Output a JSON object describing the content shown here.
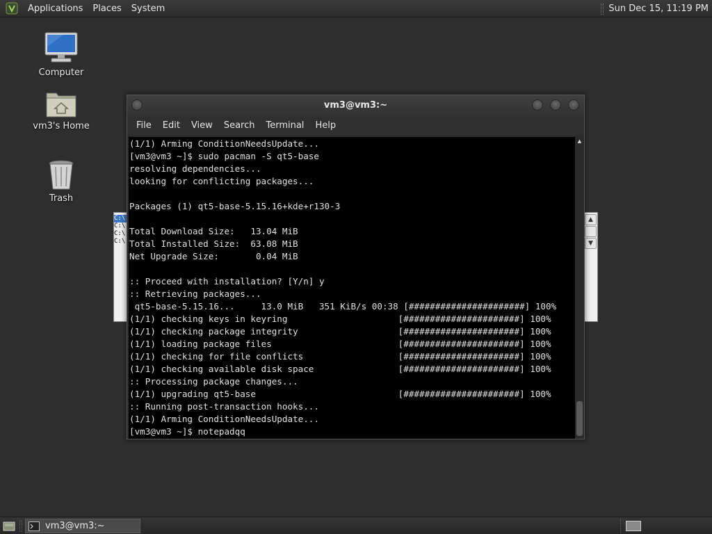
{
  "top_panel": {
    "menus": [
      "Applications",
      "Places",
      "System"
    ],
    "clock": "Sun Dec 15, 11:19 PM"
  },
  "desktop_icons": [
    {
      "label": "Computer",
      "icon": "computer-icon"
    },
    {
      "label": "vm3's Home",
      "icon": "home-folder-icon"
    },
    {
      "label": "Trash",
      "icon": "trash-icon"
    }
  ],
  "background_window": {
    "lines": [
      "C:\\",
      "C:\\",
      "C:\\",
      "C:\\"
    ]
  },
  "terminal": {
    "title": "vm3@vm3:~",
    "menu": [
      "File",
      "Edit",
      "View",
      "Search",
      "Terminal",
      "Help"
    ],
    "lines": [
      "(1/1) Arming ConditionNeedsUpdate...",
      "[vm3@vm3 ~]$ sudo pacman -S qt5-base",
      "resolving dependencies...",
      "looking for conflicting packages...",
      "",
      "Packages (1) qt5-base-5.15.16+kde+r130-3",
      "",
      "Total Download Size:   13.04 MiB",
      "Total Installed Size:  63.08 MiB",
      "Net Upgrade Size:       0.04 MiB",
      "",
      ":: Proceed with installation? [Y/n] y",
      ":: Retrieving packages...",
      " qt5-base-5.15.16...     13.0 MiB   351 KiB/s 00:38 [######################] 100%",
      "(1/1) checking keys in keyring                     [######################] 100%",
      "(1/1) checking package integrity                   [######################] 100%",
      "(1/1) loading package files                        [######################] 100%",
      "(1/1) checking for file conflicts                  [######################] 100%",
      "(1/1) checking available disk space                [######################] 100%",
      ":: Processing package changes...",
      "(1/1) upgrading qt5-base                           [######################] 100%",
      ":: Running post-transaction hooks...",
      "(1/1) Arming ConditionNeedsUpdate...",
      "[vm3@vm3 ~]$ notepadqq"
    ]
  },
  "taskbar": {
    "task_label": "vm3@vm3:~"
  }
}
